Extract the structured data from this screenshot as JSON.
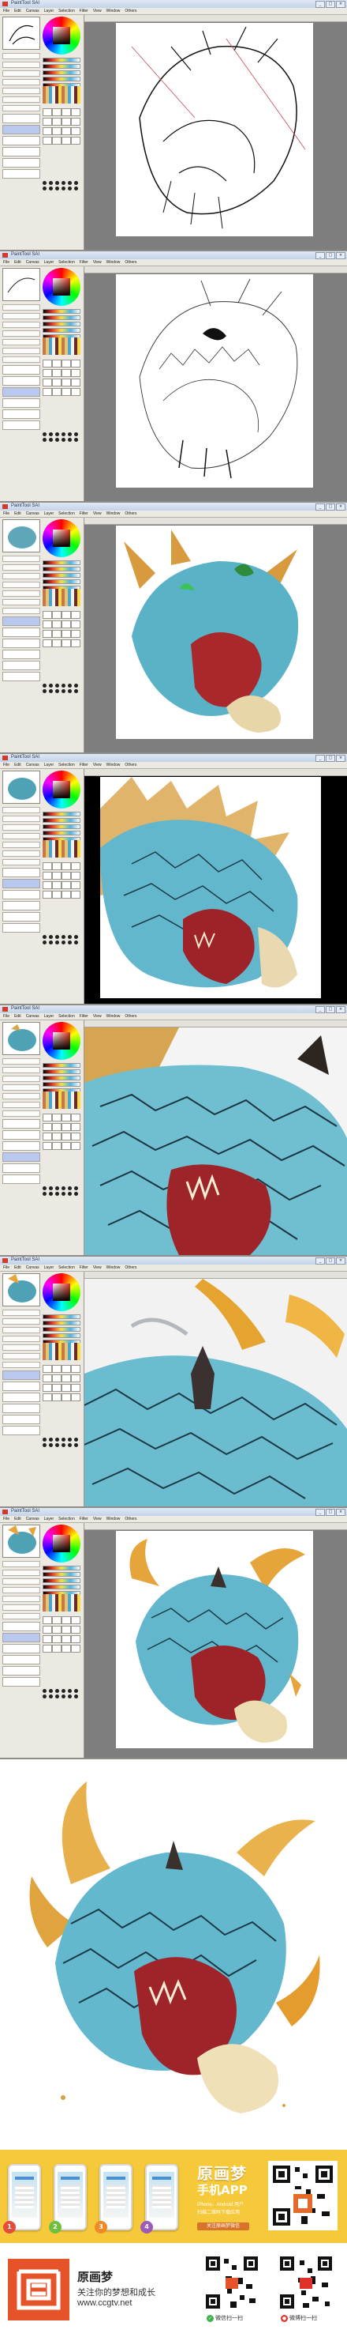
{
  "sai": {
    "window_title": "PaintTool SAI",
    "menu": [
      "File",
      "Edit",
      "Canvas",
      "Layer",
      "Selection",
      "Filter",
      "View",
      "Window",
      "Others"
    ],
    "window_buttons": [
      "_",
      "□",
      "×"
    ]
  },
  "final": {},
  "promo": {
    "title": "原画梦",
    "subtitle": "手机APP",
    "line1": "iPhone、Android 用户",
    "line2": "扫描二维码下载应用",
    "button": "关注原画梦微信",
    "badges": [
      "1",
      "2",
      "3",
      "4"
    ],
    "badge_colors": [
      "#e34d3b",
      "#6fbf3f",
      "#f08a24",
      "#9d5ab7"
    ]
  },
  "footer": {
    "brand": "原画梦",
    "slogan": "关注你的梦想和成长",
    "site": "www.ccgtv.net",
    "scan_labels": [
      "微信扫一扫",
      "微博扫一扫"
    ],
    "logo_color": "#e65328"
  }
}
